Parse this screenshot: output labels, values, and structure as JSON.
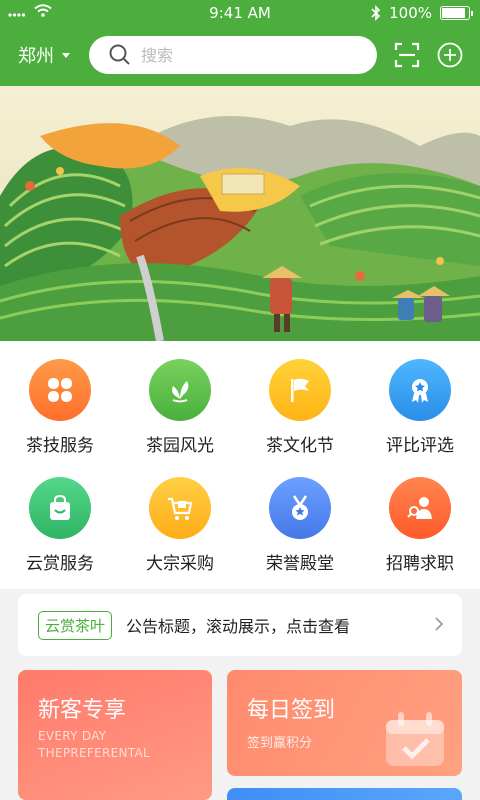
{
  "status_bar": {
    "time": "9:41 AM",
    "battery": "100%"
  },
  "header": {
    "city": "郑州",
    "search_placeholder": "搜索"
  },
  "grid": {
    "items": [
      {
        "label": "茶技服务",
        "icon": "clover-icon",
        "color": "#ff8a3d"
      },
      {
        "label": "茶园风光",
        "icon": "leaf-icon",
        "color": "#5cc14b"
      },
      {
        "label": "茶文化节",
        "icon": "flag-icon",
        "color": "#ffc21a"
      },
      {
        "label": "评比评选",
        "icon": "award-ribbon-icon",
        "color": "#3ea0f5"
      },
      {
        "label": "云赏服务",
        "icon": "shopping-bag-icon",
        "color": "#3cc277"
      },
      {
        "label": "大宗采购",
        "icon": "shopping-cart-icon",
        "color": "#ffbe2a"
      },
      {
        "label": "荣誉殿堂",
        "icon": "medal-icon",
        "color": "#5a8ff0"
      },
      {
        "label": "招聘求职",
        "icon": "recruit-search-icon",
        "color": "#ff6a3a"
      }
    ]
  },
  "notice": {
    "tag": "云赏茶叶",
    "text": "公告标题，滚动展示，点击查看"
  },
  "cards": {
    "new_customer": {
      "title": "新客专享",
      "en_line1": "EVERY DAY",
      "en_line2": "THEPREFERENTAL"
    },
    "daily_checkin": {
      "title": "每日签到",
      "subtitle": "签到赢积分"
    }
  },
  "colors": {
    "brand_green": "#4cae3c"
  }
}
